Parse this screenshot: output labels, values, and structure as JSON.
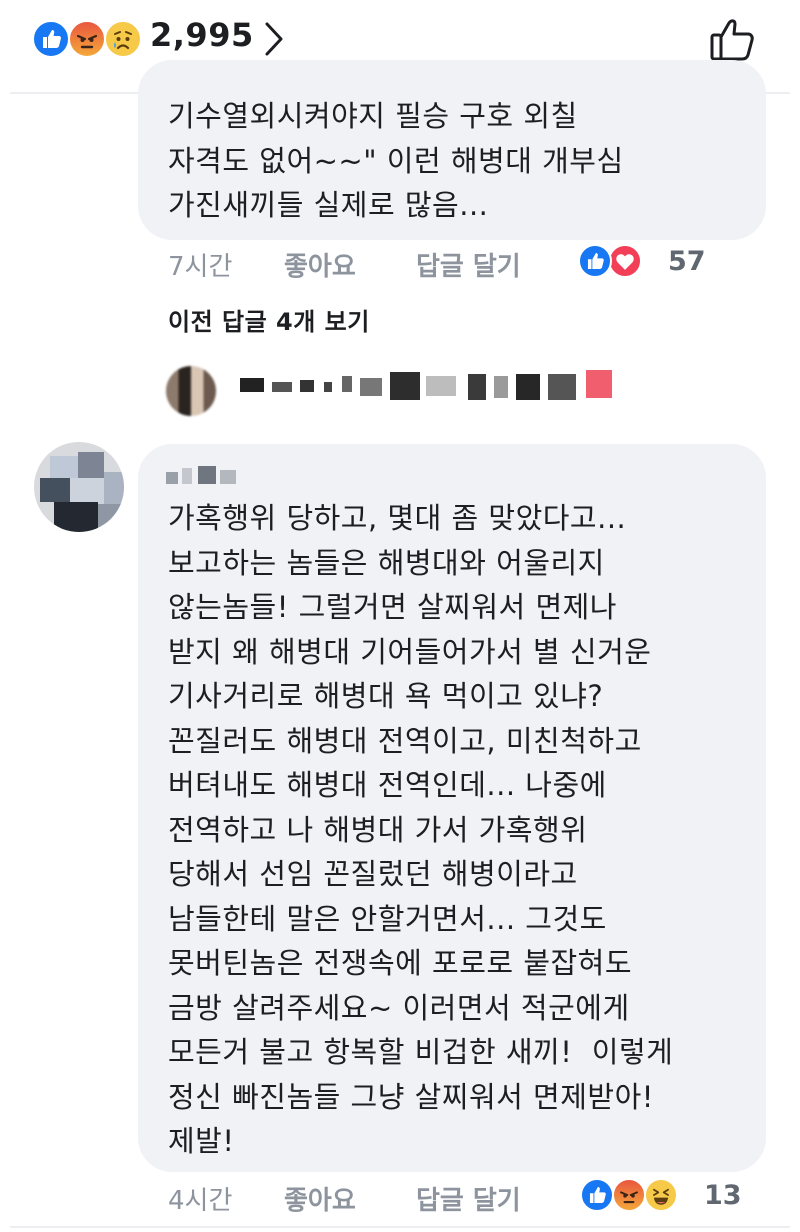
{
  "reaction_bar": {
    "reactions": [
      "like-icon",
      "angry-icon",
      "sad-icon"
    ],
    "count": "2,995",
    "colors": {
      "like": "#1877f2",
      "angry": "#f07f3b",
      "sad": "#f7c948"
    }
  },
  "comment_top": {
    "lines": [
      "기수열외시켜야지 필승 구호 외칠",
      "자격도 없어~~\" 이런 해병대 개부심",
      "가진새끼들 실제로 많음..."
    ],
    "time": "7시간",
    "like_label": "좋아요",
    "reply_label": "답글 달기",
    "reactions": [
      "like-icon",
      "love-icon"
    ],
    "reaction_count": "57"
  },
  "previous_replies_label": "이전 답글 4개 보기",
  "comment_main": {
    "lines": [
      "가혹행위 당하고, 몇대 좀 맞았다고...",
      "보고하는 놈들은 해병대와 어울리지",
      "않는놈들! 그럴거면 살찌워서 면제나",
      "받지 왜 해병대 기어들어가서 별 신거운",
      "기사거리로 해병대 욕 먹이고 있냐?",
      "꼰질러도 해병대 전역이고, 미친척하고",
      "버텨내도 해병대 전역인데... 나중에",
      "전역하고 나 해병대 가서 가혹행위",
      "당해서 선임 꼰질렀던 해병이라고",
      "남들한테 말은 안할거면서... 그것도",
      "못버틴놈은 전쟁속에 포로로 붙잡혀도",
      "금방 살려주세요~ 이러면서 적군에게",
      "모든거 불고 항복할 비겁한 새끼!  이렇게",
      "정신 빠진놈들 그냥 살찌워서 면제받아!",
      "제발!"
    ],
    "time": "4시간",
    "like_label": "좋아요",
    "reply_label": "답글 달기",
    "reactions": [
      "like-icon",
      "angry-icon",
      "haha-icon"
    ],
    "reaction_count": "13"
  }
}
